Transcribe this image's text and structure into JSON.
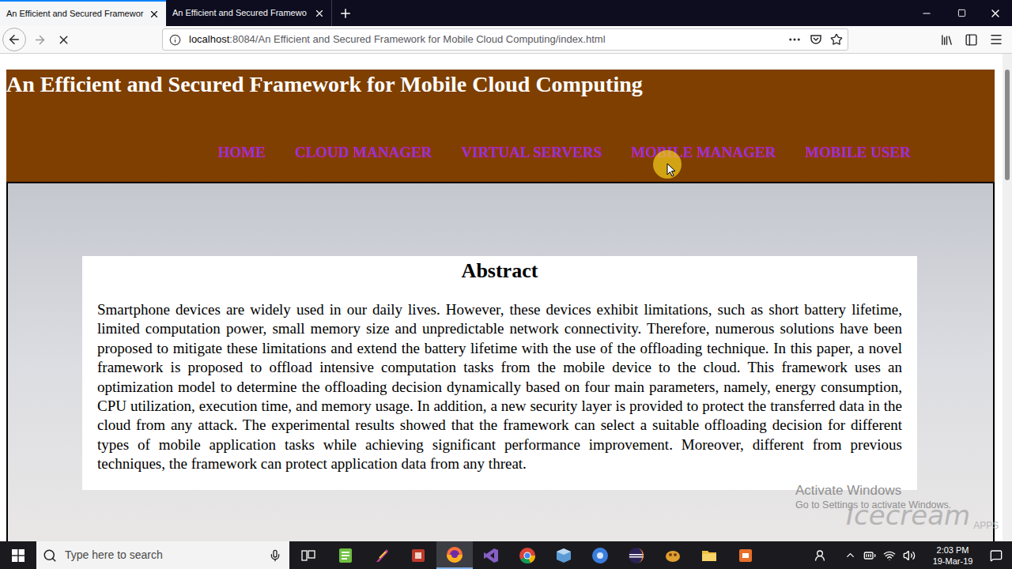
{
  "window": {
    "tabs": [
      {
        "label": "An Efficient and Secured Framewor",
        "selected": true
      },
      {
        "label": "An Efficient and Secured Framewo",
        "selected": false
      }
    ],
    "loading": true
  },
  "address_bar": {
    "host": "localhost",
    "path": ":8084/An Efficient and Secured Framework for Mobile Cloud Computing/index.html"
  },
  "page": {
    "title": "An Efficient and Secured Framework for Mobile Cloud Computing",
    "nav": [
      "HOME",
      "CLOUD MANAGER",
      "VIRTUAL SERVERS",
      "MOBILE MANAGER",
      "MOBILE USER"
    ],
    "abstract": {
      "heading": "Abstract",
      "body": "Smartphone devices are widely used in our daily lives. However, these devices exhibit limitations, such as short battery lifetime, limited computation power, small memory size and unpredictable network connectivity. Therefore, numerous solutions have been proposed to mitigate these limitations and extend the battery lifetime with the use of the offloading technique. In this paper, a novel framework is proposed to offload intensive computation tasks from the mobile device to the cloud. This framework uses an optimization model to determine the offloading decision dynamically based on four main parameters, namely, energy consumption, CPU utilization, execution time, and memory usage. In addition, a new security layer is provided to protect the transferred data in the cloud from any attack. The experimental results showed that the framework can select a suitable offloading decision for different types of mobile application tasks while achieving significant performance improvement. Moreover, different from previous techniques, the framework can protect application data from any threat."
    }
  },
  "watermark": {
    "line1": "Activate Windows",
    "line2": "Go to Settings to activate Windows.",
    "recorder": "Icecream",
    "recorder_sub": "APPS"
  },
  "taskbar": {
    "search_placeholder": "Type here to search",
    "apps": [
      {
        "active": false
      },
      {
        "active": false
      },
      {
        "active": false
      },
      {
        "active": true
      },
      {
        "active": false
      },
      {
        "active": false
      },
      {
        "active": false
      },
      {
        "active": false
      },
      {
        "active": false
      },
      {
        "active": false
      },
      {
        "active": false
      },
      {
        "active": false
      }
    ],
    "time": "2:03 PM",
    "date": "19-Mar-19"
  }
}
